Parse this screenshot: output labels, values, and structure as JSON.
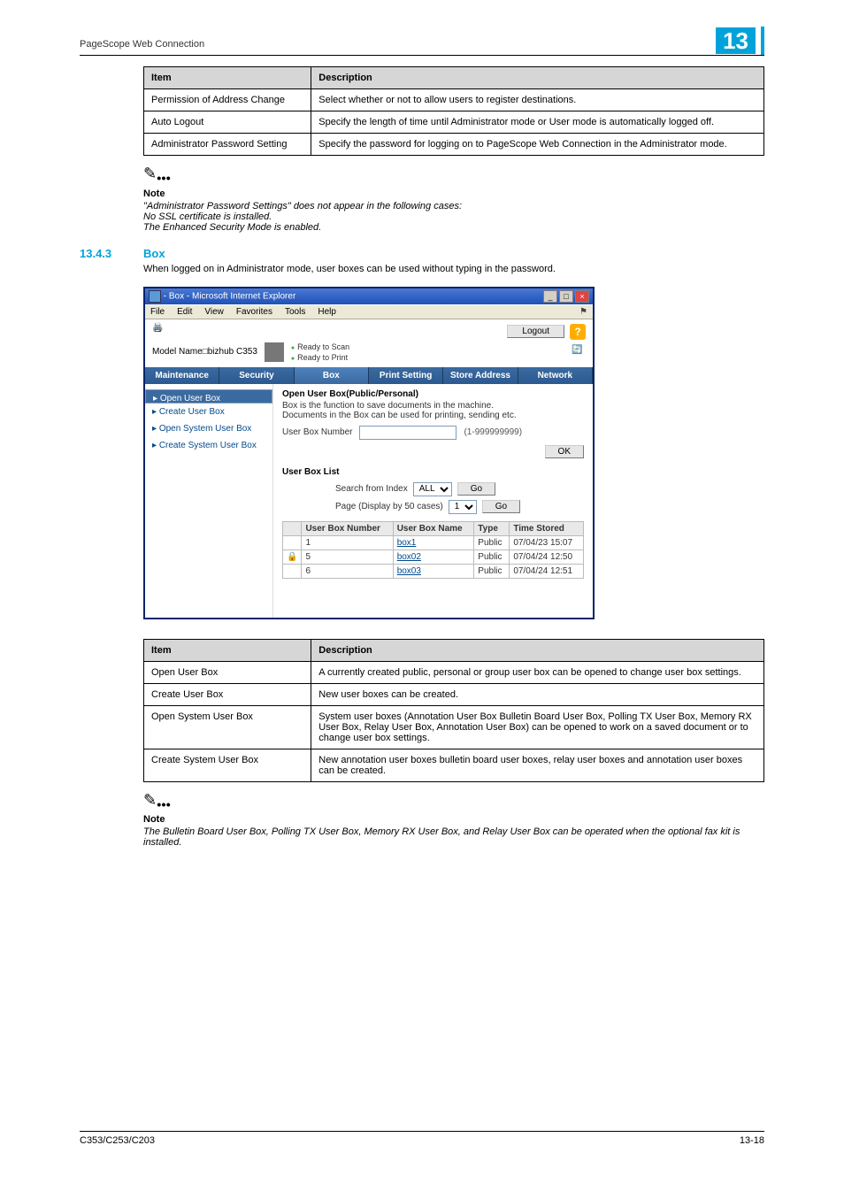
{
  "header": {
    "left": "PageScope Web Connection",
    "chapter": "13"
  },
  "table1": {
    "head": {
      "item": "Item",
      "desc": "Description"
    },
    "rows": [
      {
        "item": "Permission of Address Change",
        "desc": "Select whether or not to allow users to register destinations."
      },
      {
        "item": "Auto Logout",
        "desc": "Specify the length of time until Administrator mode or User mode is automatically logged off."
      },
      {
        "item": "Administrator Password Setting",
        "desc": "Specify the password for logging on to PageScope Web Connection in the Administrator mode."
      }
    ]
  },
  "note1": {
    "title": "Note",
    "l1": "\"Administrator Password Settings\" does not appear in the following cases:",
    "l2": "No SSL certificate is installed.",
    "l3": "The Enhanced Security Mode is enabled."
  },
  "section": {
    "num": "13.4.3",
    "title": "Box",
    "body": "When logged on in Administrator mode, user boxes can be used without typing in the password."
  },
  "ie": {
    "title": " - Box - Microsoft Internet Explorer",
    "menu": [
      "File",
      "Edit",
      "View",
      "Favorites",
      "Tools",
      "Help"
    ],
    "logout": "Logout",
    "model": "Model Name□bizhub C353",
    "status": {
      "a": "Ready to Scan",
      "b": "Ready to Print"
    },
    "tabs": [
      "Maintenance",
      "Security",
      "Box",
      "Print Setting",
      "Store Address",
      "Network"
    ],
    "side": [
      "Open User Box",
      "Create User Box",
      "Open System User Box",
      "Create System User Box"
    ],
    "panel": {
      "title": "Open User Box(Public/Personal)",
      "desc1": "Box is the function to save documents in the machine.",
      "desc2": "Documents in the Box can be used for printing, sending etc.",
      "num_label": "User Box Number",
      "num_hint": "(1-999999999)",
      "ok": "OK",
      "list_title": "User Box List",
      "search_label": "Search from Index",
      "search_all": "ALL",
      "page_label": "Page (Display by 50 cases)",
      "page_val": "1",
      "go": "Go",
      "cols": {
        "num": "User Box Number",
        "name": "User Box Name",
        "type": "Type",
        "time": "Time Stored"
      },
      "rows": [
        {
          "lock": "",
          "num": "1",
          "name": "box1",
          "type": "Public",
          "time": "07/04/23 15:07"
        },
        {
          "lock": "🔒",
          "num": "5",
          "name": "box02",
          "type": "Public",
          "time": "07/04/24 12:50"
        },
        {
          "lock": "",
          "num": "6",
          "name": "box03",
          "type": "Public",
          "time": "07/04/24 12:51"
        }
      ]
    }
  },
  "table2": {
    "head": {
      "item": "Item",
      "desc": "Description"
    },
    "rows": [
      {
        "item": "Open User Box",
        "desc": "A currently created public, personal or group user box can be opened to change user box settings."
      },
      {
        "item": "Create User Box",
        "desc": "New user boxes can be created."
      },
      {
        "item": "Open System User Box",
        "desc": "System user boxes (Annotation User Box Bulletin Board User Box, Polling TX User Box, Memory RX User Box, Relay User Box, Annotation User Box) can be opened to work on a saved document or to change user box settings."
      },
      {
        "item": "Create System User Box",
        "desc": "New annotation user boxes bulletin board user boxes, relay user boxes and annotation user boxes can be created."
      }
    ]
  },
  "note2": {
    "title": "Note",
    "body": "The Bulletin Board User Box, Polling TX User Box, Memory RX User Box, and Relay User Box can be operated when the optional fax kit is installed."
  },
  "footer": {
    "left": "C353/C253/C203",
    "right": "13-18"
  }
}
